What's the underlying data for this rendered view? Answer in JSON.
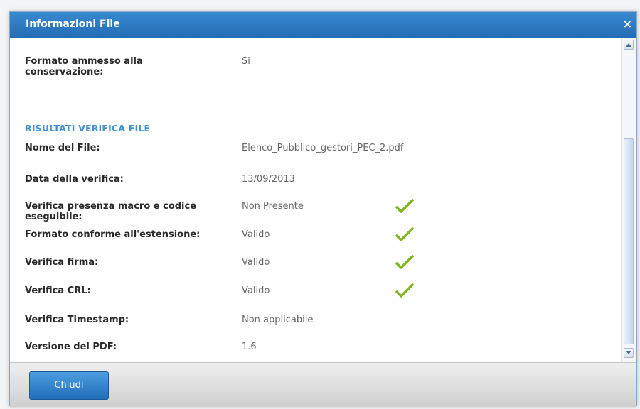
{
  "dialog": {
    "title": "Informazioni File",
    "close_icon": "×"
  },
  "top_field": {
    "label": "Formato ammesso alla conservazione:",
    "value": "Si"
  },
  "section": {
    "title": "RISULTATI VERIFICA FILE"
  },
  "fields": [
    {
      "label": "Nome del File:",
      "value": "Elenco_Pubblico_gestori_PEC_2.pdf",
      "check": false
    },
    {
      "label": "Data della verifica:",
      "value": "13/09/2013",
      "check": false
    },
    {
      "label": "Verifica presenza macro e codice eseguibile:",
      "value": "Non Presente",
      "check": true
    },
    {
      "label": "Formato conforme all'estensione:",
      "value": "Valido",
      "check": true
    },
    {
      "label": "Verifica firma:",
      "value": "Valido",
      "check": true
    },
    {
      "label": "Verifica CRL:",
      "value": "Valido",
      "check": true
    },
    {
      "label": "Verifica Timestamp:",
      "value": "Non applicabile",
      "check": false
    },
    {
      "label": "Versione del PDF:",
      "value": "1.6",
      "check": false
    }
  ],
  "footer": {
    "close_button_label": "Chiudi"
  },
  "colors": {
    "titlebar": "#236db5",
    "section_title": "#3f8fd4",
    "check": "#7fb51f"
  }
}
